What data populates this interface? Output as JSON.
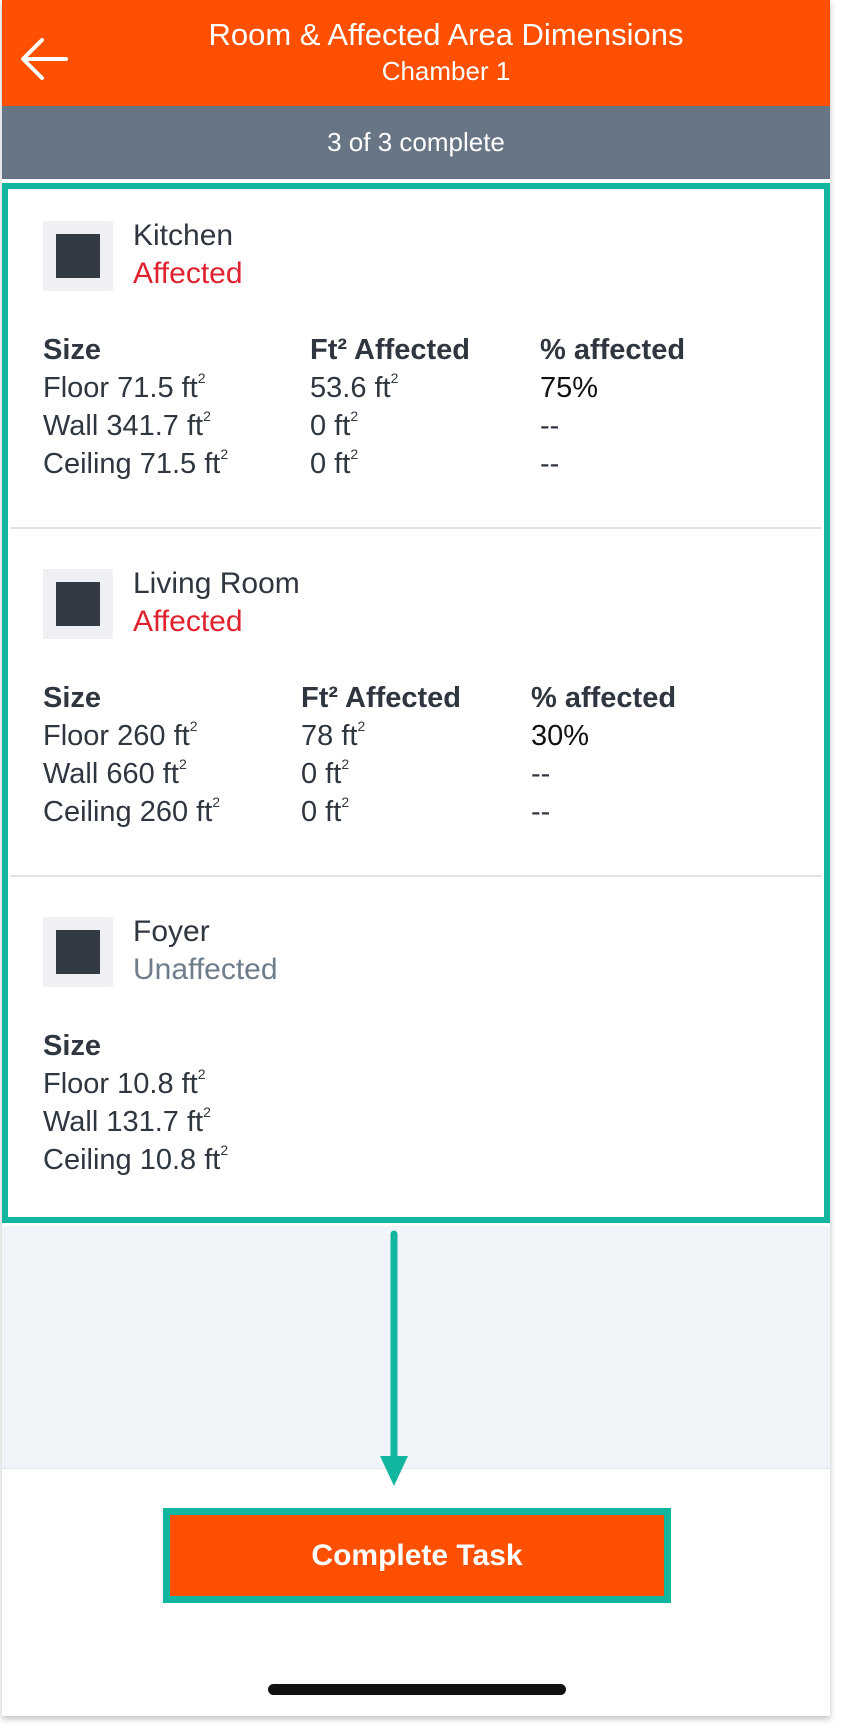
{
  "header": {
    "title": "Room & Affected Area Dimensions",
    "subtitle": "Chamber 1",
    "back_icon": "arrow-left-icon"
  },
  "progress": {
    "text": "3 of 3 complete",
    "completed": 3,
    "total": 3
  },
  "rooms": [
    {
      "name": "Kitchen",
      "status": "Affected",
      "size_header": "Size",
      "affected_header": "Ft² Affected",
      "percent_header": "% affected",
      "rows": [
        {
          "label": "Floor 71.5 ft",
          "affected": "53.6 ft",
          "percent": "75%"
        },
        {
          "label": "Wall 341.7 ft",
          "affected": "0 ft",
          "percent": "--"
        },
        {
          "label": "Ceiling 71.5 ft",
          "affected": "0 ft",
          "percent": "--"
        }
      ]
    },
    {
      "name": "Living Room",
      "status": "Affected",
      "size_header": "Size",
      "affected_header": "Ft² Affected",
      "percent_header": "% affected",
      "rows": [
        {
          "label": "Floor 260 ft",
          "affected": "78 ft",
          "percent": "30%"
        },
        {
          "label": "Wall 660 ft",
          "affected": "0 ft",
          "percent": "--"
        },
        {
          "label": "Ceiling 260 ft",
          "affected": "0 ft",
          "percent": "--"
        }
      ]
    },
    {
      "name": "Foyer",
      "status": "Unaffected",
      "size_header": "Size",
      "rows": [
        {
          "label": "Floor 10.8 ft"
        },
        {
          "label": "Wall 131.7 ft"
        },
        {
          "label": "Ceiling 10.8 ft"
        }
      ]
    }
  ],
  "unit_superscript": "2",
  "complete_button": {
    "label": "Complete Task"
  },
  "colors": {
    "brand_orange": "#ff4f00",
    "progress_grey": "#687585",
    "highlight_teal": "#12b59e",
    "affected_red": "#e0212e",
    "unaffected_grey": "#6e7c8c"
  }
}
